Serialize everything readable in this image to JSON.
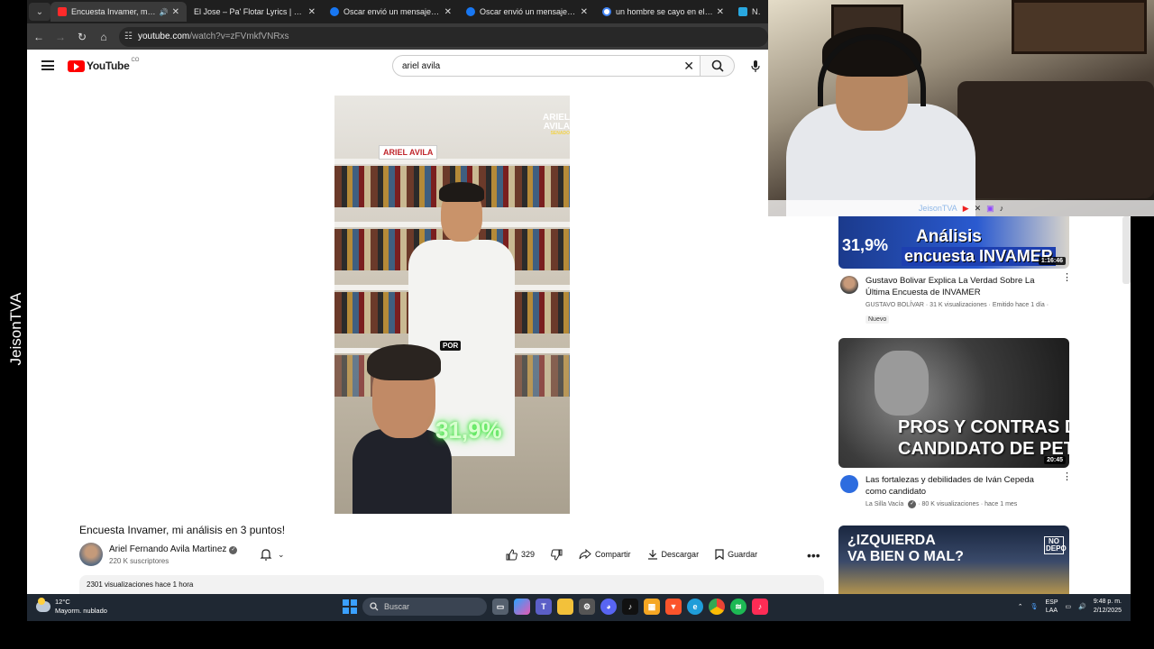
{
  "browser": {
    "tabs": [
      {
        "title": "Encuesta Invamer, mi análisis",
        "active": true,
        "fav": "#ff2a2a"
      },
      {
        "title": "El Jose – Pa' Flotar Lyrics | Genius",
        "active": false,
        "fav": "#f2f2f2"
      },
      {
        "title": "Oscar envió un mensaje a Oscar",
        "active": false,
        "fav": "#1877f2"
      },
      {
        "title": "Oscar envió un mensaje a Oscar",
        "active": false,
        "fav": "#1877f2"
      },
      {
        "title": "un hombre se cayo en el octavo",
        "active": false,
        "fav": "#ffffff"
      },
      {
        "title": "Notici",
        "active": false,
        "fav": "#29a8e0"
      }
    ],
    "url_host": "youtube.com",
    "url_path": "/watch?v=zFVmkfVNRxs"
  },
  "youtube": {
    "logo_text": "YouTube",
    "logo_cc": "CO",
    "search_value": "ariel avila",
    "video": {
      "overlay_brand": "ARIEL AVILA",
      "overlay_sub": "SENADO",
      "sign_text": "ARIEL AVILA",
      "caption": "POR",
      "percent": "31,9%"
    },
    "title": "Encuesta Invamer, mi análisis en 3 puntos!",
    "channel_name": "Ariel Fernando Avila Martinez",
    "subscribers": "220 K suscriptores",
    "likes": "329",
    "share_label": "Compartir",
    "download_label": "Descargar",
    "save_label": "Guardar",
    "description_meta": "2301 visualizaciones  hace 1 hora"
  },
  "recommendations": [
    {
      "thumb_text1": "Análisis",
      "thumb_text2": "encuesta INVAMER",
      "thumb_pct": "31,9%",
      "duration": "1:16:46",
      "title": "Gustavo Bolivar Explica La Verdad Sobre La Última Encuesta de INVAMER",
      "channel": "GUSTAVO BOLÍVAR · 31 K visualizaciones · Emitido hace 1 día ·",
      "badge": "Nuevo"
    },
    {
      "thumb_text1": "PROS Y CONTRAS DEL",
      "thumb_text2": "CANDIDATO DE PETRO",
      "duration": "20:45",
      "title": "Las fortalezas y debilidades de Iván Cepeda como candidato",
      "channel": "La Silla Vacía",
      "meta": "· 80 K visualizaciones · hace 1 mes"
    },
    {
      "thumb_text1": "¿IZQUIERDA",
      "thumb_text2": "VA BIEN O MAL?",
      "thumb_badge": "NO DEPO"
    }
  ],
  "overlay": {
    "streamer_tag": "JeisonTVA",
    "watermark": "JeisonTVA"
  },
  "taskbar": {
    "temp": "12°C",
    "weather": "Mayorm. nublado",
    "search_placeholder": "Buscar",
    "lang1": "ESP",
    "lang2": "LAA",
    "time": "9:48 p. m.",
    "date": "2/12/2025"
  }
}
